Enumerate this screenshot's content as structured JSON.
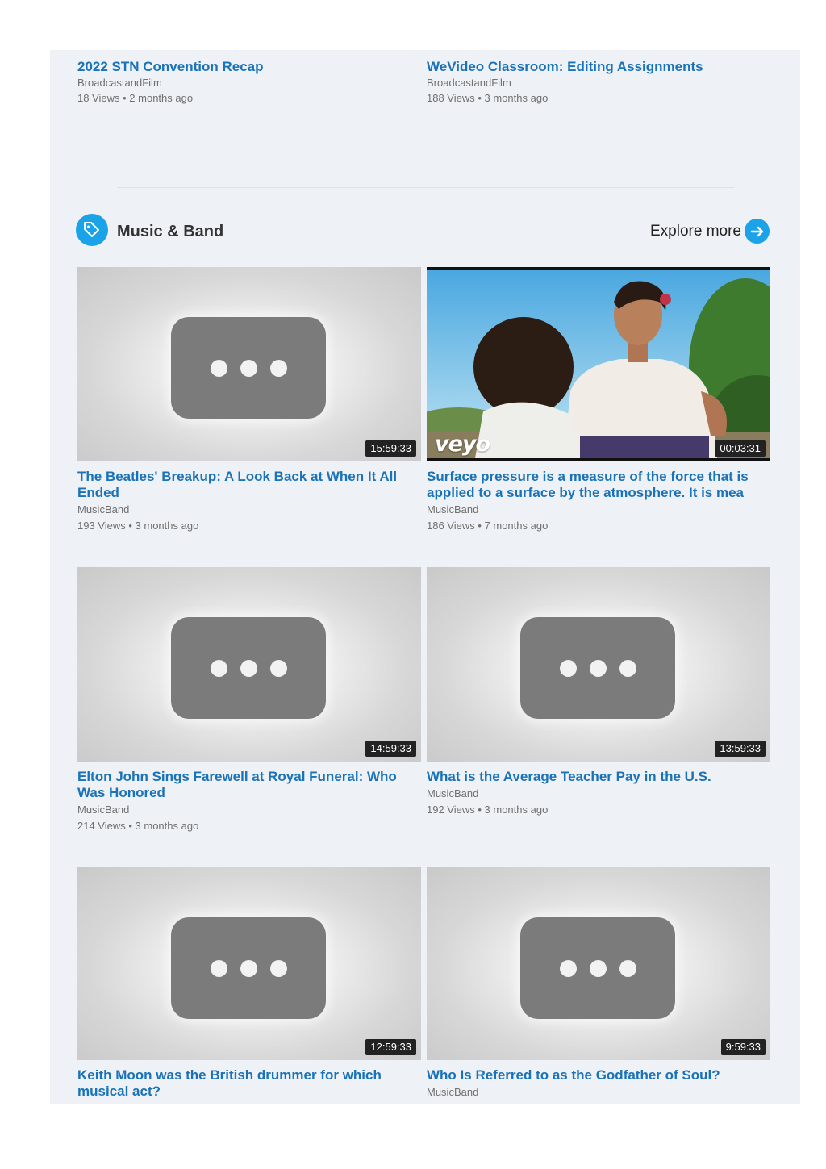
{
  "top_items": [
    {
      "title": "2022 STN Convention Recap",
      "channel": "BroadcastandFilm",
      "views": "18 Views",
      "sep": " • ",
      "age": "2 months ago"
    },
    {
      "title": "WeVideo Classroom: Editing Assignments",
      "channel": "BroadcastandFilm",
      "views": "188 Views",
      "sep": " • ",
      "age": "3 months ago"
    }
  ],
  "section": {
    "title": "Music & Band",
    "icon": "tag-icon",
    "explore_label": "Explore more",
    "explore_icon": "arrow-right-icon",
    "accent": "#1aa3e8"
  },
  "videos": [
    {
      "title": "The Beatles' Breakup: A Look Back at When It All Ended",
      "channel": "MusicBand",
      "views": "193 Views",
      "sep": " • ",
      "age": "3 months ago",
      "duration": "15:59:33"
    },
    {
      "title": "Surface pressure is a measure of the force that is applied to a surface by the atmosphere. It is mea",
      "channel": "MusicBand",
      "views": "186 Views",
      "sep": " • ",
      "age": "7 months ago",
      "duration": "00:03:31",
      "watermark": "veyo"
    },
    {
      "title": "Elton John Sings Farewell at Royal Funeral: Who Was Honored",
      "channel": "MusicBand",
      "views": "214 Views",
      "sep": " • ",
      "age": "3 months ago",
      "duration": "14:59:33"
    },
    {
      "title": "What is the Average Teacher Pay in the U.S.",
      "channel": "MusicBand",
      "views": "192 Views",
      "sep": " • ",
      "age": "3 months ago",
      "duration": "13:59:33"
    },
    {
      "title": "Keith Moon was the British drummer for which musical act?",
      "duration": "12:59:33"
    },
    {
      "title": "Who Is Referred to as the Godfather of Soul?",
      "channel": "MusicBand",
      "duration": "9:59:33"
    }
  ],
  "colors": {
    "link": "#1a73b8",
    "meta": "#707070",
    "panel": "#eef1f5"
  }
}
